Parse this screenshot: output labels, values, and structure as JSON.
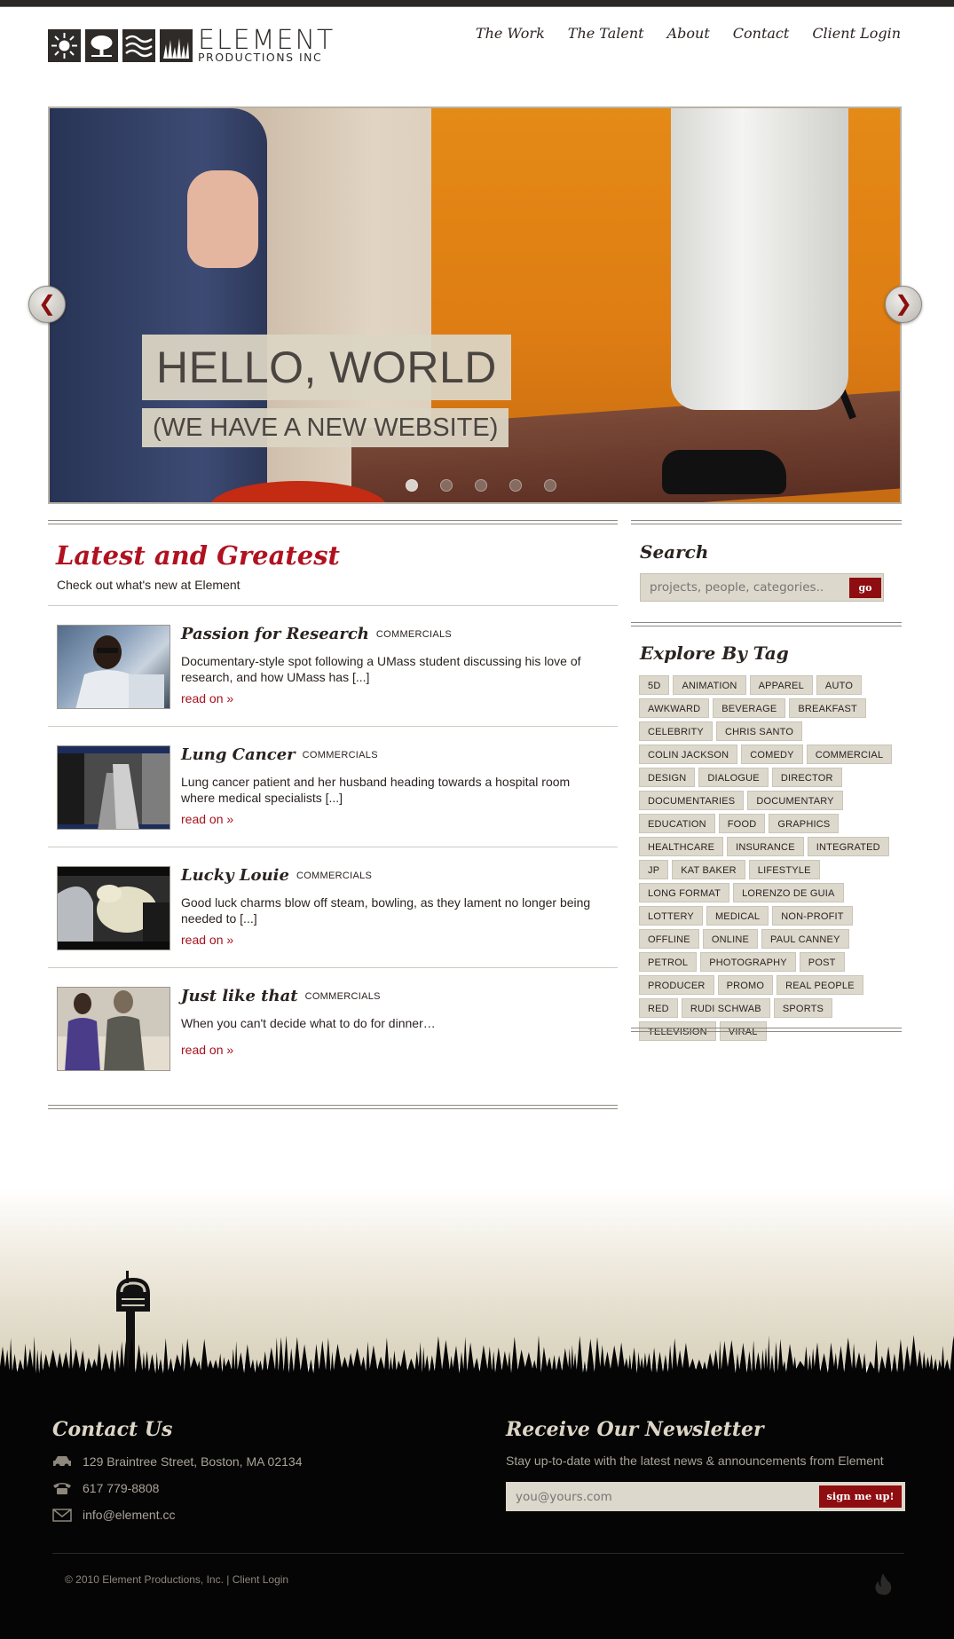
{
  "brand": {
    "name": "Element",
    "subname": "Productions Inc",
    "tiles": [
      "sun-icon",
      "tree-icon",
      "waves-icon",
      "grass-icon"
    ]
  },
  "nav": [
    "The Work",
    "The Talent",
    "About",
    "Contact",
    "Client Login"
  ],
  "slider": {
    "headline": "HELLO, WORLD",
    "subline": "(WE HAVE A NEW WEBSITE)",
    "prev_glyph": "❮",
    "next_glyph": "❯",
    "slide_count": 5,
    "active_slide": 1
  },
  "main": {
    "title": "Latest and Greatest",
    "subtitle": "Check out what's new at Element",
    "posts": [
      {
        "title": "Passion for Research",
        "category": "COMMERCIALS",
        "excerpt": "Documentary-style spot following a UMass student discussing his love of research, and how UMass has [...]",
        "link": "read on »"
      },
      {
        "title": "Lung Cancer",
        "category": "COMMERCIALS",
        "excerpt": "Lung cancer patient and her husband heading towards a hospital room where medical specialists [...]",
        "link": "read on »"
      },
      {
        "title": "Lucky Louie",
        "category": "COMMERCIALS",
        "excerpt": "Good luck charms blow off steam, bowling, as they lament no longer being needed to [...]",
        "link": "read on »"
      },
      {
        "title": "Just like that",
        "category": "COMMERCIALS",
        "excerpt": "When you can't decide what to do for dinner…",
        "link": "read on »"
      }
    ]
  },
  "sidebar": {
    "search_title": "Search",
    "search_placeholder": "projects, people, categories..",
    "search_button": "go",
    "tags_title": "Explore By Tag",
    "tags": [
      "5D",
      "ANIMATION",
      "APPAREL",
      "AUTO",
      "AWKWARD",
      "BEVERAGE",
      "BREAKFAST",
      "CELEBRITY",
      "CHRIS SANTO",
      "COLIN JACKSON",
      "COMEDY",
      "COMMERCIAL",
      "DESIGN",
      "DIALOGUE",
      "DIRECTOR",
      "DOCUMENTARIES",
      "DOCUMENTARY",
      "EDUCATION",
      "FOOD",
      "GRAPHICS",
      "HEALTHCARE",
      "INSURANCE",
      "INTEGRATED",
      "JP",
      "KAT BAKER",
      "LIFESTYLE",
      "LONG FORMAT",
      "LORENZO DE GUIA",
      "LOTTERY",
      "MEDICAL",
      "NON-PROFIT",
      "OFFLINE",
      "ONLINE",
      "PAUL CANNEY",
      "PETROL",
      "PHOTOGRAPHY",
      "POST",
      "PRODUCER",
      "PROMO",
      "REAL PEOPLE",
      "RED",
      "RUDI SCHWAB",
      "SPORTS",
      "TELEVISION",
      "VIRAL"
    ]
  },
  "footer": {
    "contact_title": "Contact Us",
    "address": "129 Braintree Street, Boston, MA 02134",
    "phone": "617 779-8808",
    "email": "info@element.cc",
    "newsletter_title": "Receive Our Newsletter",
    "newsletter_desc": "Stay up-to-date with the latest news & announcements from Element",
    "newsletter_placeholder": "you@yours.com",
    "newsletter_button": "sign me up!",
    "copyright": "© 2010 Element Productions, Inc. |",
    "client_login": "Client Login",
    "colors": {
      "accent": "#8e0d11",
      "title_red": "#b01220",
      "footer_bg": "#050505"
    }
  }
}
